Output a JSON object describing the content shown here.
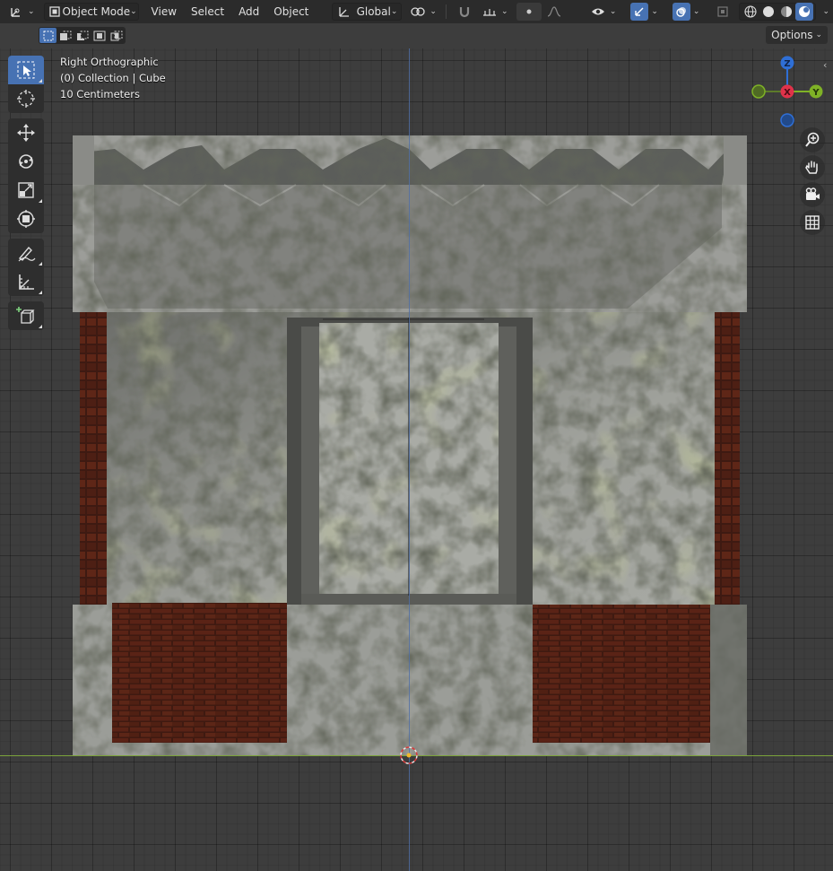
{
  "header": {
    "mode_label": "Object Mode",
    "menus": [
      "View",
      "Select",
      "Add",
      "Object"
    ],
    "orientation_label": "Global",
    "options_label": "Options"
  },
  "overlay": {
    "view_name": "Right Orthographic",
    "collection": "(0) Collection | Cube",
    "scale": "10 Centimeters"
  },
  "gizmo": {
    "z_label": "Z",
    "x_label": "X",
    "y_label": "Y",
    "colors": {
      "x": "#e0324a",
      "y": "#7fb226",
      "z": "#2f6fd6"
    }
  },
  "icons": {
    "editor_type": "axes-icon",
    "tools": [
      "select-box-icon",
      "cursor-icon",
      "move-icon",
      "rotate-icon",
      "scale-icon",
      "transform-icon",
      "annotate-icon",
      "measure-icon",
      "add-cube-icon"
    ],
    "nav": [
      "zoom-icon",
      "pan-hand-icon",
      "camera-icon",
      "grid-icon"
    ]
  },
  "theme": {
    "accent": "#4772b3",
    "header_bg": "#2b2b2b",
    "viewport_bg": "#3d3d3d"
  }
}
